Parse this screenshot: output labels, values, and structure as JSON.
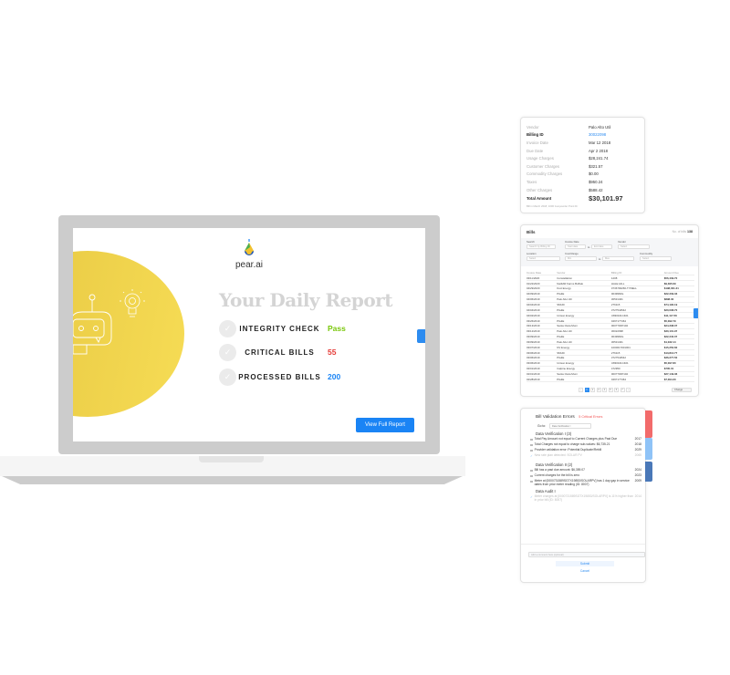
{
  "laptop": {
    "logo_text": "pear.ai",
    "title": "Your Daily Report",
    "rows": [
      {
        "label": "INTEGRITY CHECK",
        "value": "Pass",
        "color": "#7ac70c"
      },
      {
        "label": "CRITICAL BILLS",
        "value": "55",
        "color": "#e53935"
      },
      {
        "label": "PROCESSED BILLS",
        "value": "200",
        "color": "#1a84f5"
      }
    ],
    "button": "View Full Report"
  },
  "invoice": {
    "rows": [
      [
        "Vendor",
        "Palo Alto Util"
      ],
      [
        "Billing ID",
        "30022098"
      ],
      [
        "Invoice Date",
        "Mar 12 2018"
      ],
      [
        "Due Date",
        "Apr 2 2018"
      ],
      [
        "Usage Charges",
        "$28,241.74"
      ],
      [
        "Customer Charges",
        "$321.57"
      ],
      [
        "Commodity Charges",
        "$0.00"
      ],
      [
        "Taxes",
        "$950.24"
      ],
      [
        "Other Charges",
        "$588.42"
      ]
    ],
    "total_label": "Total Amount",
    "total": "$30,101.97",
    "footnote": "Bill in March 2018, 1000 Gunpowder Point Dr"
  },
  "bills": {
    "title": "Bills",
    "count_label": "No. of bills",
    "count": "138",
    "filters": {
      "search": "Search",
      "search_ph": "Search by Billing ID",
      "invoice_date": "Invoice Date",
      "start": "Start date",
      "to": "to",
      "end": "End date",
      "vendor": "Vendor",
      "select": "Select",
      "location": "Location",
      "cost_range": "Cost Range",
      "min": "Min",
      "max": "Max",
      "commodity": "Commodity"
    },
    "columns": [
      "Invoice Date",
      "Vendor",
      "Billing ID",
      "Amount Due"
    ],
    "rows": [
      [
        "03/11/2020",
        "Constellation",
        "1208",
        "$56,439.70"
      ],
      [
        "01/22/2020",
        "NatFAR Farms Buffalo",
        "HALE HILL",
        "$9,395.69"
      ],
      [
        "04/29/2020",
        "Kcol Energy",
        "0736790266-TYRELL",
        "$198,001.21"
      ],
      [
        "04/09/2019",
        "PG&E",
        "0049960ls",
        "$22,339.33"
      ],
      [
        "04/06/2019",
        "Palo Alto Util",
        "30531401",
        "$898.30"
      ],
      [
        "04/04/2019",
        "SMUD",
        "276115",
        "$74,190.19"
      ],
      [
        "04/04/2019",
        "PG&E",
        "3727544542",
        "$20,008.70"
      ],
      [
        "04/02/2019",
        "Unison Energy",
        "U830101C401",
        "$11,117.56"
      ],
      [
        "03/26/2019",
        "PG&E",
        "0497177464",
        "$5,092.79"
      ],
      [
        "03/13/2019",
        "Santa Clara Muni",
        "000770FP102",
        "$24,338.07"
      ],
      [
        "03/12/2019",
        "Palo Alto Util",
        "30022098",
        "$30,101.97"
      ],
      [
        "03/09/2019",
        "PG&E",
        "0049960ls",
        "$22,340.07"
      ],
      [
        "03/09/2019",
        "Palo Alto Util",
        "30531401",
        "$1,032.14"
      ],
      [
        "03/07/2019",
        "NV Energy",
        "1000017001001",
        "$15,250.60"
      ],
      [
        "03/06/2019",
        "SMUD",
        "276115",
        "$13,812.77"
      ],
      [
        "03/06/2019",
        "PG&E",
        "3727544542",
        "$36,277.50"
      ],
      [
        "03/06/2019",
        "Unison Energy",
        "U830101C401",
        "$5,097.80"
      ],
      [
        "02/01/2019",
        "Calpine Energy",
        "472950",
        "$705.01"
      ],
      [
        "02/01/2019",
        "Santa Clara Muni",
        "000770FP102",
        "$27,149.36"
      ],
      [
        "02/28/2019",
        "PG&E",
        "0497177464",
        "$7,094.33"
      ]
    ],
    "pages": [
      "‹",
      "1",
      "2",
      "3",
      "4",
      "5",
      "6",
      "7",
      "›"
    ],
    "current_page": "1",
    "change": "Change"
  },
  "validation": {
    "title": "Bill Validation Errors",
    "critical": "5 Critical Errors",
    "goto": "Go to:",
    "goto_value": "Data Verification I",
    "sections": [
      {
        "title": "Data Verification I (3)",
        "items": [
          {
            "text": "Total Pay Amount not equal to Current Charges plus Past Due",
            "code": "2017",
            "done": false
          },
          {
            "text": "Total Charges not equal to charge sub-values: $6,735.21",
            "code": "2018",
            "done": false
          },
          {
            "text": "Provider validation error: Potential Duplicate/Rebill",
            "code": "2029",
            "done": false
          },
          {
            "text": "New rate plan detected: SOLAR PV",
            "code": "2065",
            "done": true
          }
        ]
      },
      {
        "title": "Data Verification II (2)",
        "items": [
          {
            "text": "Bill has a past due amount: $6,359.07",
            "code": "2024",
            "done": false
          },
          {
            "text": "Current charges for the bill is zero",
            "code": "2023",
            "done": false
          },
          {
            "text": "Meter at [0000731589SGTX19853/SOLARPV] has 1 day gap in service dates from prior meter reading (ID: 8007)",
            "code": "2009",
            "done": false
          }
        ]
      },
      {
        "title": "Data Audit I",
        "items": [
          {
            "text": "Meter charges at [0000731589SGTX19853/SOLARPV] is 11% higher than in prior bill (ID: 8007)",
            "code": "2014",
            "done": true
          }
        ]
      }
    ],
    "comment_ph": "Add a comment here (optional)",
    "submit": "Submit",
    "cancel": "Cancel",
    "tab_colors": [
      "#f26b6b",
      "#8fc3f7",
      "#4a78b8"
    ]
  }
}
